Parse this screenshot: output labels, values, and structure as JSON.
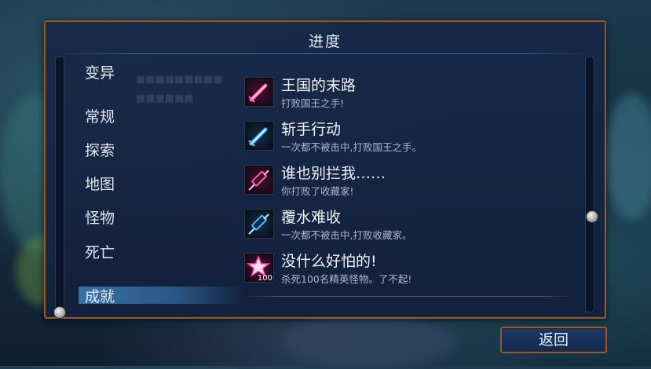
{
  "panel": {
    "title": "进度"
  },
  "categories": [
    {
      "id": "variant",
      "label": "变异"
    },
    {
      "id": "general",
      "label": "常规"
    },
    {
      "id": "explore",
      "label": "探索"
    },
    {
      "id": "map",
      "label": "地图"
    },
    {
      "id": "monster",
      "label": "怪物"
    },
    {
      "id": "death",
      "label": "死亡"
    },
    {
      "id": "achievement",
      "label": "成就",
      "selected": true
    }
  ],
  "achievements": [
    {
      "title": "王国的末路",
      "desc": "打败国王之手!",
      "icon": "pink-sword-icon",
      "color": "#e0307a"
    },
    {
      "title": "斩手行动",
      "desc": "一次都不被击中,打败国王之手。",
      "icon": "blue-sword-icon",
      "color": "#3aa8e8"
    },
    {
      "title": "谁也别拦我……",
      "desc": "你打败了收藏家!",
      "icon": "pink-syringe-icon",
      "color": "#e0307a"
    },
    {
      "title": "覆水难收",
      "desc": "一次都不被击中,打败收藏家。",
      "icon": "blue-syringe-icon",
      "color": "#3aa8e8"
    },
    {
      "title": "没什么好怕的!",
      "desc": "杀死100名精英怪物。了不起!",
      "icon": "pink-star-icon",
      "color": "#e0307a",
      "badge": "100"
    }
  ],
  "footer": {
    "back_label": "返回"
  }
}
